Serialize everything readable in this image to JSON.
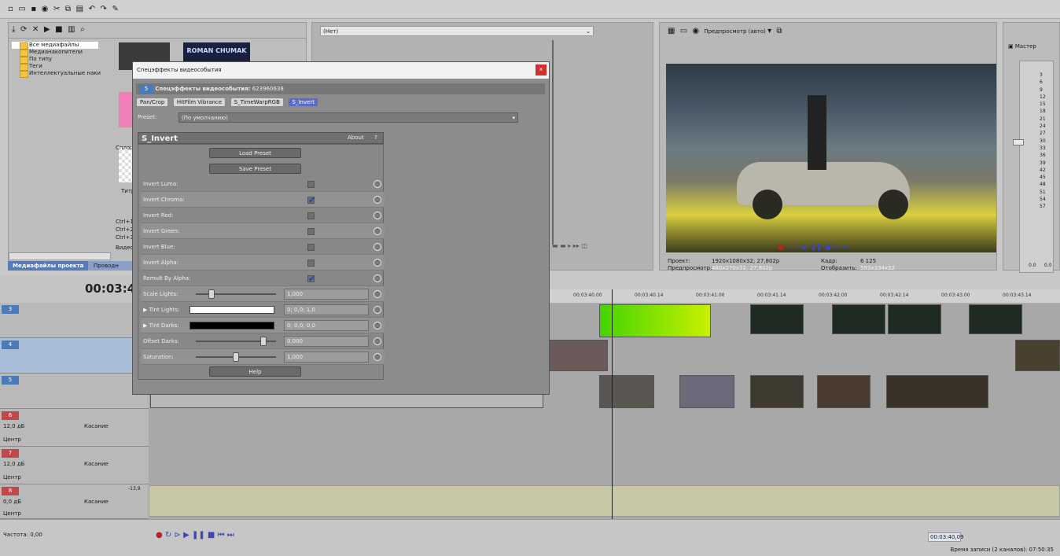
{
  "explorer": {
    "tree": [
      "Все медиафайлы",
      "Медианакопители",
      "По типу",
      "Теги",
      "Интеллектуальные наки"
    ],
    "thumb_title": "ROMAN CHUMAK",
    "tabs": [
      "Медиафайлы проекта",
      "Проводн"
    ],
    "side_labels": [
      "Сплош",
      "Титр",
      "Ctrl+1",
      "Ctrl+2",
      "Ctrl+3",
      "Видео:"
    ]
  },
  "trimmer": {
    "selector": "(Нет)"
  },
  "preview": {
    "mode": "Предпросмотр (авто)",
    "project_label": "Проект:",
    "project_value": "1920x1080x32; 27,802p",
    "preview_label": "Предпросмотр:",
    "preview_value": "480x270x32; 27,802p",
    "frame_label": "Кадр:",
    "frame_value": "6 125",
    "display_label": "Отобразить:",
    "display_value": "593x334x32"
  },
  "master": {
    "title": "Мастер",
    "scale": [
      "3",
      "6",
      "9",
      "12",
      "15",
      "18",
      "21",
      "24",
      "27",
      "30",
      "33",
      "36",
      "39",
      "42",
      "45",
      "48",
      "51",
      "54",
      "57"
    ],
    "readout": [
      "0.0",
      "0.0"
    ]
  },
  "fx_dialog": {
    "title": "Спецэффекты видеособытия",
    "close": "x",
    "chain_label": "Спецэффекты видеособытия:",
    "chain_id": "623960638",
    "chain": [
      "Pan/Crop",
      "HitFilm Vibrance",
      "S_TimeWarpRGB",
      "S_Invert"
    ],
    "preset_label": "Preset:",
    "preset_value": "(По умолчанию)",
    "plugin_name": "S_Invert",
    "about": "About",
    "help_q": "?",
    "load": "Load Preset",
    "save": "Save Preset",
    "params": [
      {
        "label": "Invert Luma:",
        "checked": false
      },
      {
        "label": "Invert Chroma:",
        "checked": true
      },
      {
        "label": "Invert Red:",
        "checked": false
      },
      {
        "label": "Invert Green:",
        "checked": false
      },
      {
        "label": "Invert Blue:",
        "checked": false
      },
      {
        "label": "Invert Alpha:",
        "checked": false
      },
      {
        "label": "Remult By Alpha:",
        "checked": true
      }
    ],
    "scale_lights": {
      "label": "Scale Lights:",
      "value": "1,000"
    },
    "tint_lights": {
      "label": "Tint Lights:",
      "value": "0; 0,0; 1,0"
    },
    "tint_darks": {
      "label": "Tint Darks:",
      "value": "0; 0,0; 0,0"
    },
    "offset_darks": {
      "label": "Offset Darks:",
      "value": "0,000"
    },
    "saturation": {
      "label": "Saturation:",
      "value": "1,000"
    },
    "help": "Help"
  },
  "timeline": {
    "time": "00:03:40,",
    "ticks": [
      "00:03:40.00",
      "00:03:40.14",
      "00:03:41.00",
      "00:03:41.14",
      "00:03:42.00",
      "00:03:42.14",
      "00:03:43.00",
      "00:03:43.14"
    ],
    "tracks": [
      {
        "num": "3",
        "kind": "video"
      },
      {
        "num": "4",
        "kind": "video"
      },
      {
        "num": "5",
        "kind": "video"
      },
      {
        "num": "6",
        "kind": "audio",
        "vol": "12,0 дБ",
        "pan": "Центр",
        "mode": "Касание"
      },
      {
        "num": "7",
        "kind": "audio",
        "vol": "12,0 дБ",
        "pan": "Центр",
        "mode": "Касание"
      },
      {
        "num": "8",
        "kind": "audio",
        "vol": "0,0 дБ",
        "pan": "Центр",
        "mode": "Касание",
        "peak": "-13,9"
      }
    ]
  },
  "status": {
    "rate": "Частота: 0,00",
    "cursor": "00:03:40,09",
    "record_time": "Время записи (2 каналов): 07:50:35"
  }
}
